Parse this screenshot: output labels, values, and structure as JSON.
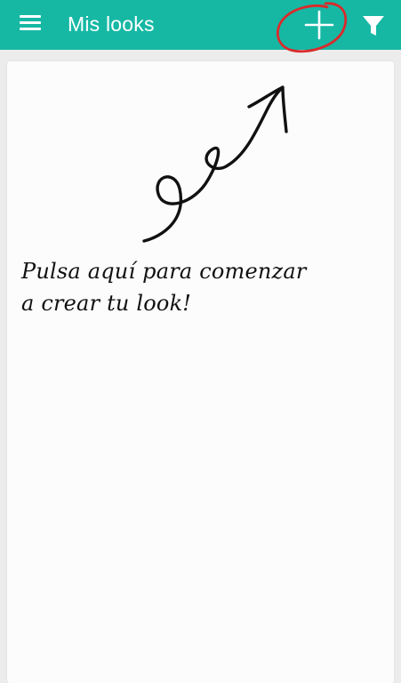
{
  "app_bar": {
    "title": "Mis looks",
    "background_color": "#16b8a4",
    "menu_icon": "hamburger-menu-icon",
    "add_icon": "plus-icon",
    "filter_icon": "filter-funnel-icon"
  },
  "empty_state": {
    "hint_line1": "Pulsa aquí para comenzar",
    "hint_line2": "a crear tu look!",
    "annotation_color": "#d92b2b"
  }
}
